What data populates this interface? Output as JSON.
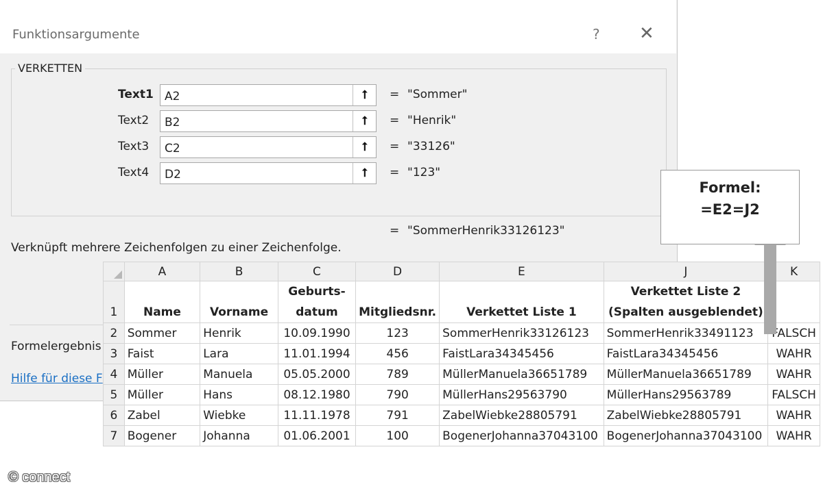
{
  "dialog": {
    "title": "Funktionsargumente",
    "help_button": "?",
    "close_button": "✕",
    "function_name": "VERKETTEN",
    "args": [
      {
        "label": "Text1",
        "input": "A2",
        "value": "\"Sommer\""
      },
      {
        "label": "Text2",
        "input": "B2",
        "value": "\"Henrik\""
      },
      {
        "label": "Text3",
        "input": "C2",
        "value": "\"33126\""
      },
      {
        "label": "Text4",
        "input": "D2",
        "value": "\"123\""
      }
    ],
    "equals": "=",
    "result": "\"SommerHenrik33126123\"",
    "description": "Verknüpft mehrere Zeichenfolgen zu einer Zeichenfolge.",
    "formula_result_label": "Formelergebnis",
    "help_link": "Hilfe für diese F"
  },
  "sheet": {
    "columns": [
      "A",
      "B",
      "C",
      "D",
      "E",
      "J",
      "K"
    ],
    "header_row_number": "1",
    "headers": [
      {
        "line1": "",
        "line2": "Name"
      },
      {
        "line1": "",
        "line2": "Vorname"
      },
      {
        "line1": "Geburts-",
        "line2": "datum"
      },
      {
        "line1": "",
        "line2": "Mitgliedsnr."
      },
      {
        "line1": "",
        "line2": "Verkettet Liste 1"
      },
      {
        "line1": "Verkettet Liste 2",
        "line2": "(Spalten ausgeblendet)"
      },
      {
        "line1": "",
        "line2": ""
      }
    ],
    "rows": [
      {
        "num": "2",
        "cells": [
          "Sommer",
          "Henrik",
          "10.09.1990",
          "123",
          "SommerHenrik33126123",
          "SommerHenrik33491123",
          "FALSCH"
        ]
      },
      {
        "num": "3",
        "cells": [
          "Faist",
          "Lara",
          "11.01.1994",
          "456",
          "FaistLara34345456",
          "FaistLara34345456",
          "WAHR"
        ]
      },
      {
        "num": "4",
        "cells": [
          "Müller",
          "Manuela",
          "05.05.2000",
          "789",
          "MüllerManuela36651789",
          "MüllerManuela36651789",
          "WAHR"
        ]
      },
      {
        "num": "5",
        "cells": [
          "Müller",
          "Hans",
          "08.12.1980",
          "790",
          "MüllerHans29563790",
          "MüllerHans29563789",
          "FALSCH"
        ]
      },
      {
        "num": "6",
        "cells": [
          "Zabel",
          "Wiebke",
          "11.11.1978",
          "791",
          "ZabelWiebke28805791",
          "ZabelWiebke28805791",
          "WAHR"
        ]
      },
      {
        "num": "7",
        "cells": [
          "Bogener",
          "Johanna",
          "01.06.2001",
          "100",
          "BogenerJohanna37043100",
          "BogenerJohanna37043100",
          "WAHR"
        ]
      }
    ]
  },
  "callout": {
    "line1": "Formel:",
    "line2": "=E2=J2"
  },
  "watermark": "© connect"
}
